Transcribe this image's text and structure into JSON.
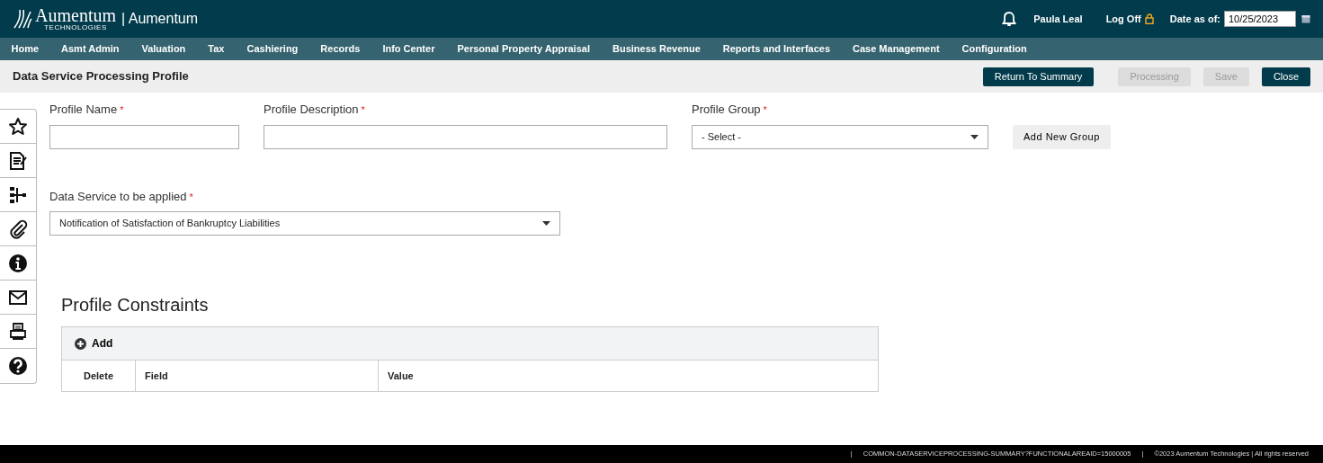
{
  "header": {
    "logo_text": "Aumentum",
    "logo_subtext": "TECHNOLOGIES",
    "app_title": "| Aumentum",
    "user": "Paula Leal",
    "logoff": "Log Off",
    "date_label": "Date as of:",
    "date_value": "10/25/2023"
  },
  "nav": [
    "Home",
    "Asmt Admin",
    "Valuation",
    "Tax",
    "Cashiering",
    "Records",
    "Info Center",
    "Personal Property Appraisal",
    "Business Revenue",
    "Reports and Interfaces",
    "Case Management",
    "Configuration"
  ],
  "page_title": "Data Service Processing Profile",
  "actions": [
    {
      "label": "Return To Summary",
      "disabled": false
    },
    {
      "label": "Processing",
      "disabled": true
    },
    {
      "label": "Save",
      "disabled": true
    },
    {
      "label": "Close",
      "disabled": false
    }
  ],
  "form": {
    "row_1": [
      {
        "label": "Profile Name",
        "required_mark": "*",
        "kind": "text"
      },
      {
        "label": "Profile Description",
        "required_mark": "*",
        "kind": "text"
      },
      {
        "label": "Profile Group",
        "required_mark": "*",
        "kind": "select",
        "value": "- Select -"
      }
    ],
    "add_group_button": "Add New Group",
    "data_service": {
      "label": "Data Service to be applied",
      "required_mark": "*",
      "kind": "select",
      "value": "Notification of Satisfaction of Bankruptcy Liabilities"
    }
  },
  "constraints": {
    "title": "Profile Constraints",
    "add_button": "Add",
    "columns": [
      "Delete",
      "Field",
      "Value"
    ]
  },
  "footer": {
    "separator": "|",
    "path": "COMMON-DATASERVICEPROCESSING-SUMMARY?FUNCTIONALAREAID=15000005",
    "copyright": "©2023 Aumentum Technologies | All rights reserved"
  }
}
